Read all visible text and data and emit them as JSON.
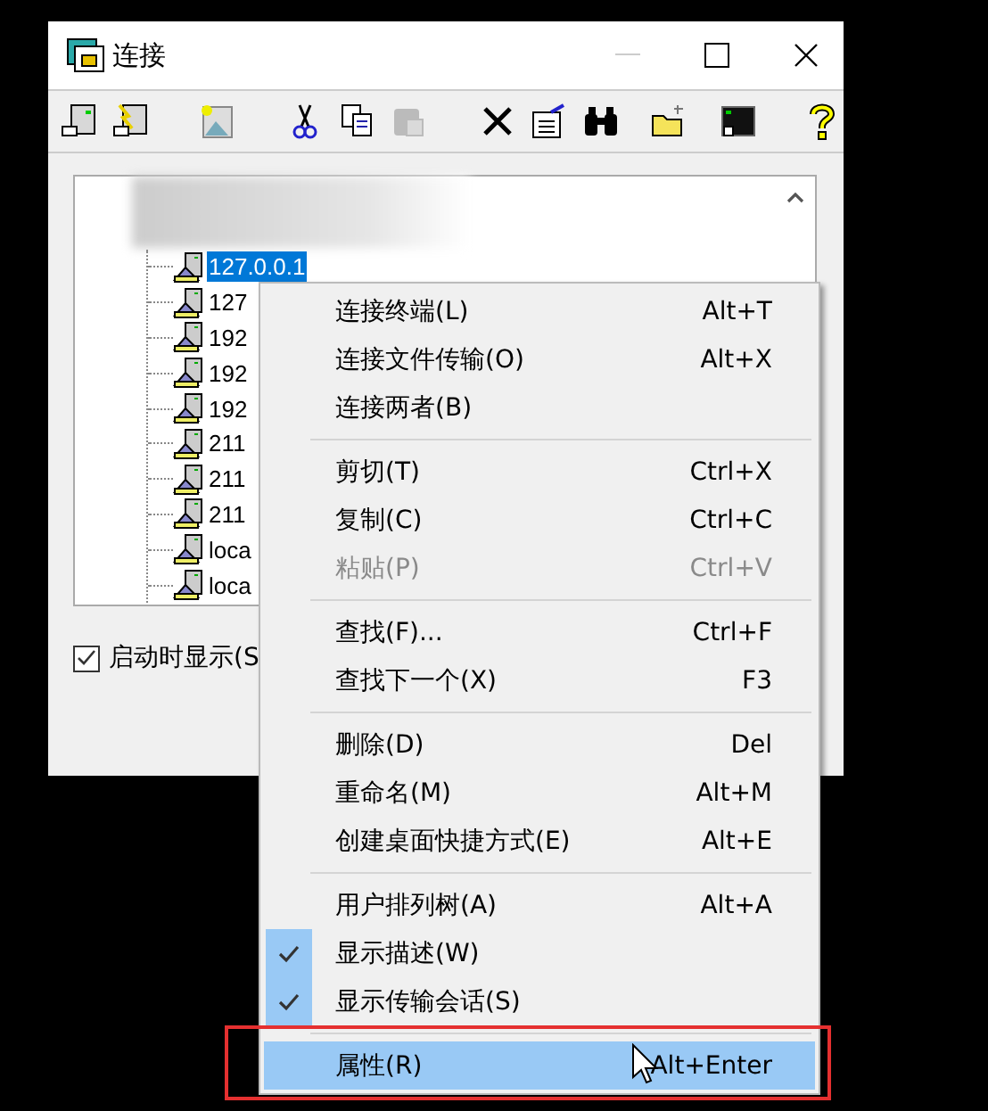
{
  "window": {
    "title": "连接"
  },
  "toolbar": [
    {
      "kind": "connect",
      "disabled": false
    },
    {
      "kind": "quick-connect",
      "disabled": false
    },
    {
      "kind": "new-session",
      "disabled": false
    },
    {
      "kind": "cut",
      "disabled": false
    },
    {
      "kind": "copy",
      "disabled": false
    },
    {
      "kind": "paste",
      "disabled": true
    },
    {
      "kind": "delete",
      "disabled": false
    },
    {
      "kind": "properties",
      "disabled": false
    },
    {
      "kind": "find",
      "disabled": false
    },
    {
      "kind": "new-folder",
      "disabled": false
    },
    {
      "kind": "terminal",
      "disabled": false
    },
    {
      "kind": "help",
      "disabled": false
    }
  ],
  "sessions": [
    {
      "label": "127.0.0.1",
      "selected": true
    },
    {
      "label": "127",
      "selected": false
    },
    {
      "label": "192",
      "selected": false
    },
    {
      "label": "192",
      "selected": false
    },
    {
      "label": "192",
      "selected": false
    },
    {
      "label": "211",
      "selected": false
    },
    {
      "label": "211",
      "selected": false
    },
    {
      "label": "211",
      "selected": false
    },
    {
      "label": "loca",
      "selected": false
    },
    {
      "label": "loca",
      "selected": false
    }
  ],
  "startup_checkbox": {
    "label": "启动时显示(S",
    "checked": true
  },
  "context_menu": [
    {
      "kind": "item",
      "label": "连接终端(L)",
      "shortcut": "Alt+T",
      "disabled": false,
      "checked": false,
      "selected": false
    },
    {
      "kind": "item",
      "label": "连接文件传输(O)",
      "shortcut": "Alt+X",
      "disabled": false,
      "checked": false,
      "selected": false
    },
    {
      "kind": "item",
      "label": "连接两者(B)",
      "disabled": false,
      "checked": false,
      "selected": false
    },
    {
      "kind": "separator"
    },
    {
      "kind": "item",
      "label": "剪切(T)",
      "shortcut": "Ctrl+X",
      "disabled": false,
      "checked": false,
      "selected": false
    },
    {
      "kind": "item",
      "label": "复制(C)",
      "shortcut": "Ctrl+C",
      "disabled": false,
      "checked": false,
      "selected": false
    },
    {
      "kind": "item",
      "label": "粘贴(P)",
      "shortcut": "Ctrl+V",
      "disabled": true,
      "checked": false,
      "selected": false
    },
    {
      "kind": "separator"
    },
    {
      "kind": "item",
      "label": "查找(F)...",
      "shortcut": "Ctrl+F",
      "disabled": false,
      "checked": false,
      "selected": false
    },
    {
      "kind": "item",
      "label": "查找下一个(X)",
      "shortcut": "F3",
      "disabled": false,
      "checked": false,
      "selected": false
    },
    {
      "kind": "separator"
    },
    {
      "kind": "item",
      "label": "删除(D)",
      "shortcut": "Del",
      "disabled": false,
      "checked": false,
      "selected": false
    },
    {
      "kind": "item",
      "label": "重命名(M)",
      "shortcut": "Alt+M",
      "disabled": false,
      "checked": false,
      "selected": false
    },
    {
      "kind": "item",
      "label": "创建桌面快捷方式(E)",
      "shortcut": "Alt+E",
      "disabled": false,
      "checked": false,
      "selected": false
    },
    {
      "kind": "separator"
    },
    {
      "kind": "item",
      "label": "用户排列树(A)",
      "shortcut": "Alt+A",
      "disabled": false,
      "checked": false,
      "selected": false
    },
    {
      "kind": "item",
      "label": "显示描述(W)",
      "disabled": false,
      "checked": true,
      "selected": false
    },
    {
      "kind": "item",
      "label": "显示传输会话(S)",
      "disabled": false,
      "checked": true,
      "selected": false
    },
    {
      "kind": "separator"
    },
    {
      "kind": "item",
      "label": "属性(R)",
      "shortcut": "Alt+Enter",
      "disabled": false,
      "checked": false,
      "selected": true
    }
  ]
}
